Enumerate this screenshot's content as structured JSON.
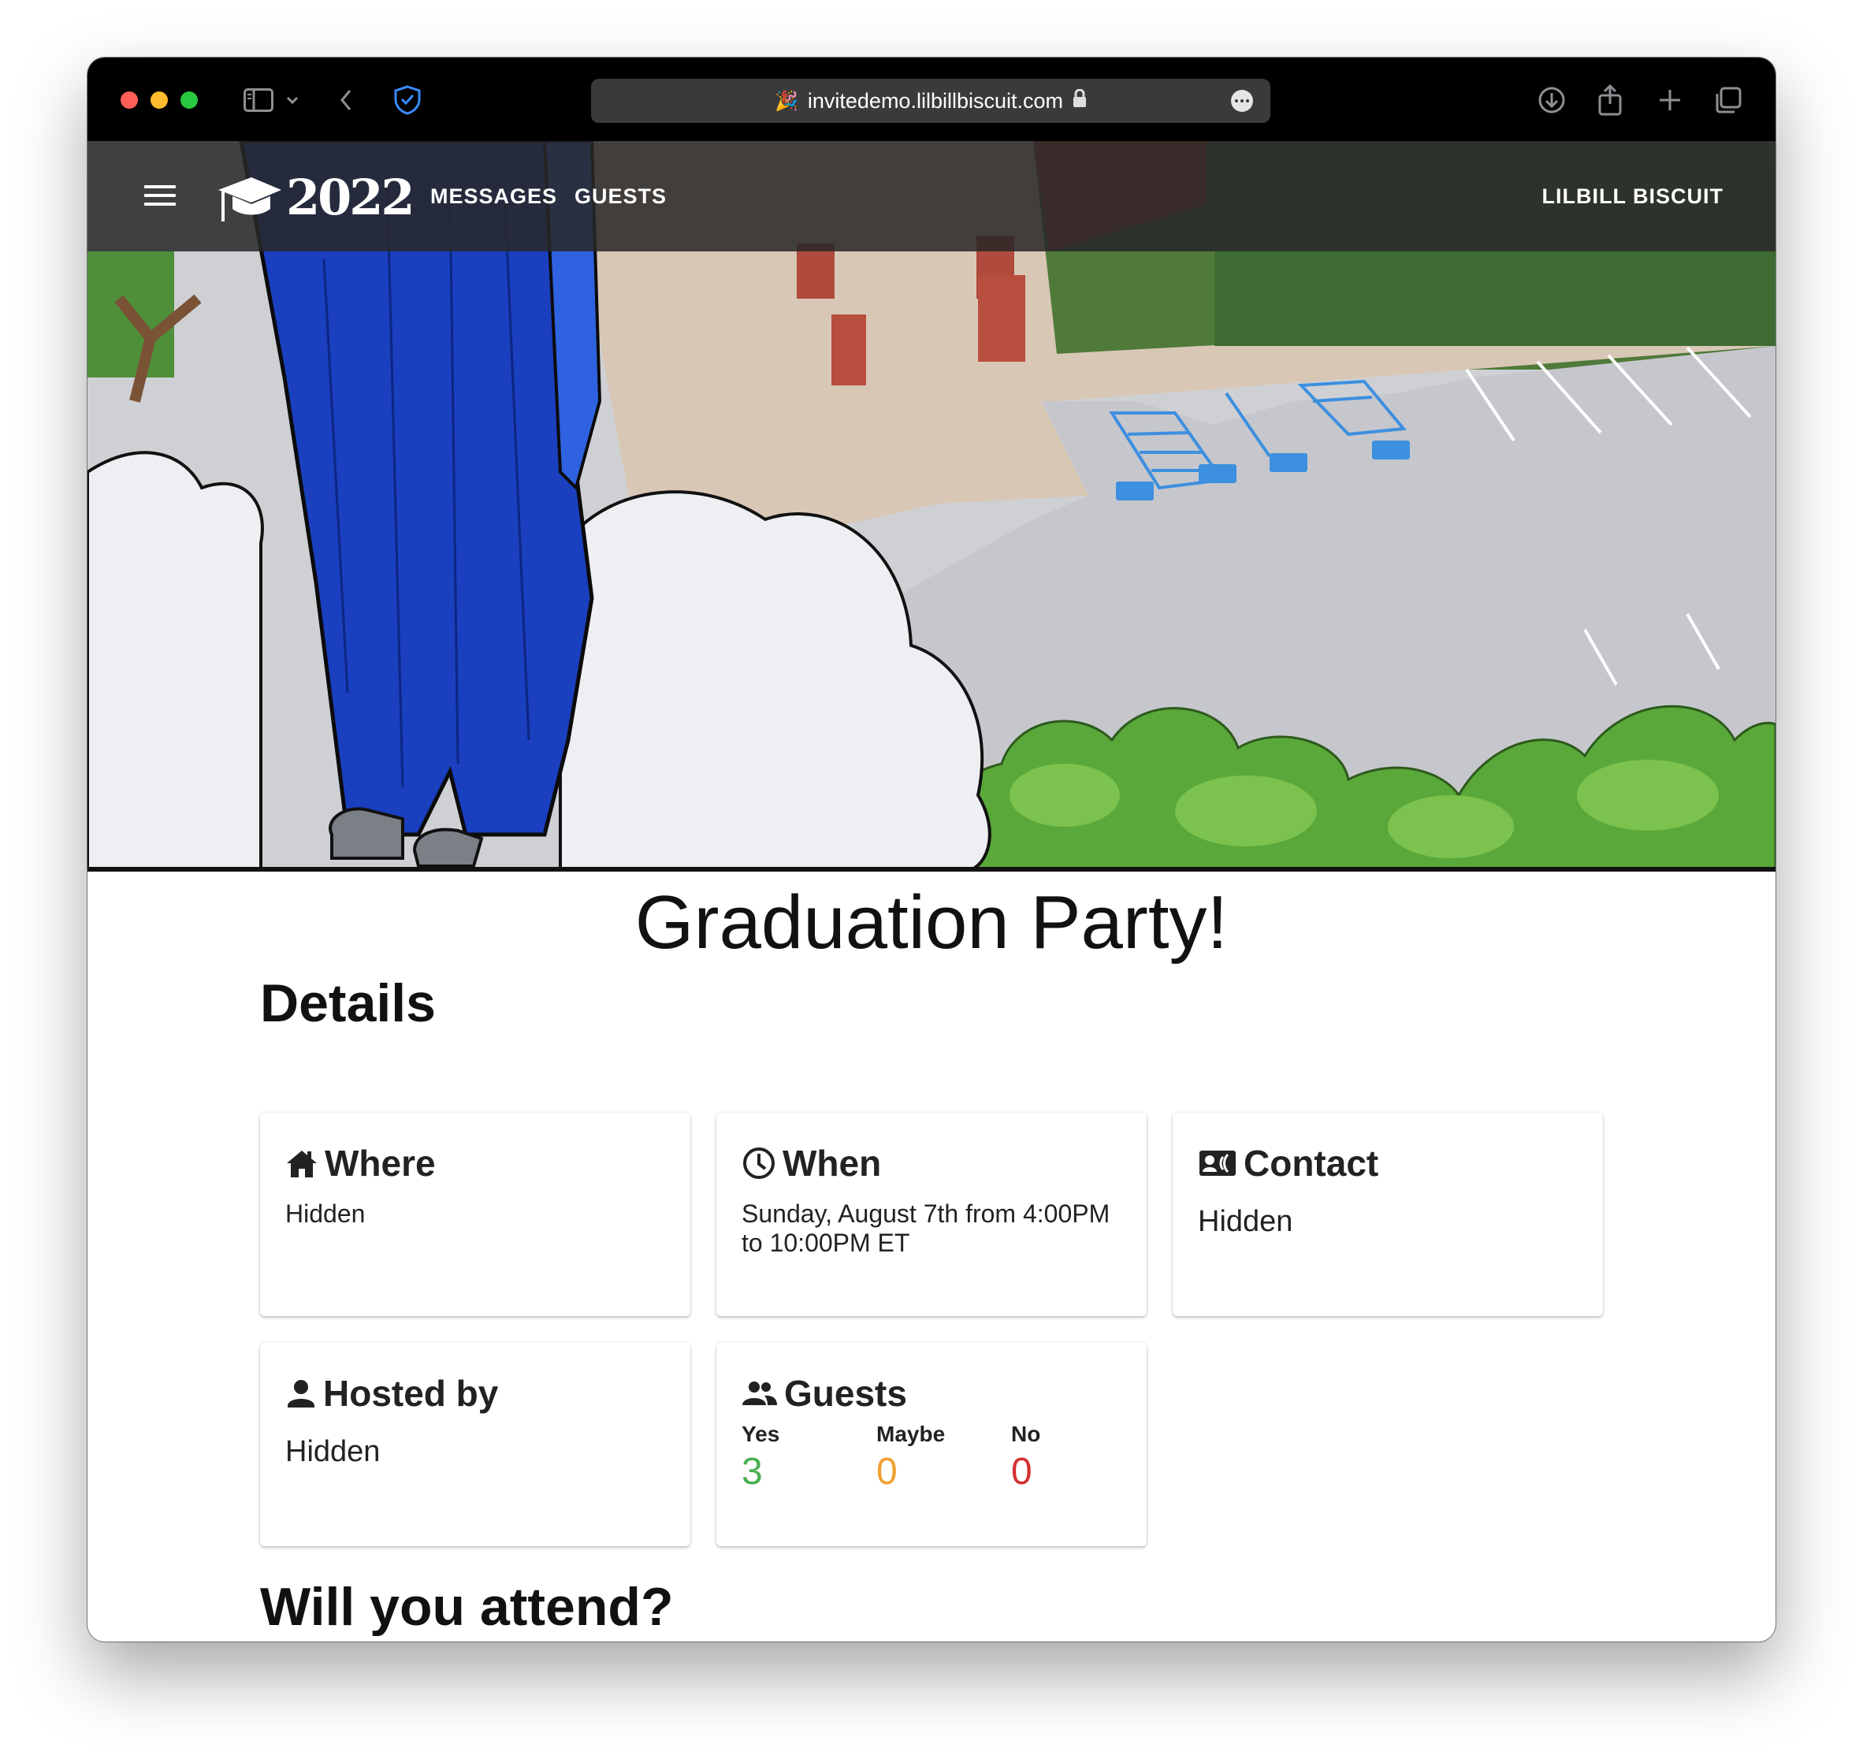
{
  "browser": {
    "url": "invitedemo.lilbillbiscuit.com",
    "favicon": "party-popper-icon"
  },
  "appbar": {
    "logo_year": "2022",
    "nav": [
      "MESSAGES",
      "GUESTS"
    ],
    "user": "LILBILL BISCUIT"
  },
  "page": {
    "title": "Graduation Party!",
    "details_heading": "Details",
    "attend_heading": "Will you attend?"
  },
  "cards": {
    "where": {
      "title": "Where",
      "value": "Hidden",
      "icon": "home-icon"
    },
    "when": {
      "title": "When",
      "value": "Sunday, August 7th from 4:00PM to 10:00PM ET",
      "icon": "clock-icon"
    },
    "contact": {
      "title": "Contact",
      "value": "Hidden",
      "icon": "contact-card-icon"
    },
    "host": {
      "title": "Hosted by",
      "value": "Hidden",
      "icon": "person-icon"
    },
    "guests": {
      "title": "Guests",
      "icon": "people-icon",
      "yes_label": "Yes",
      "yes_count": "3",
      "maybe_label": "Maybe",
      "maybe_count": "0",
      "no_label": "No",
      "no_count": "0"
    }
  },
  "colors": {
    "yes": "#4caf50",
    "maybe": "#f0a030",
    "no": "#d32f2f",
    "gown": "#1a3fbf"
  }
}
